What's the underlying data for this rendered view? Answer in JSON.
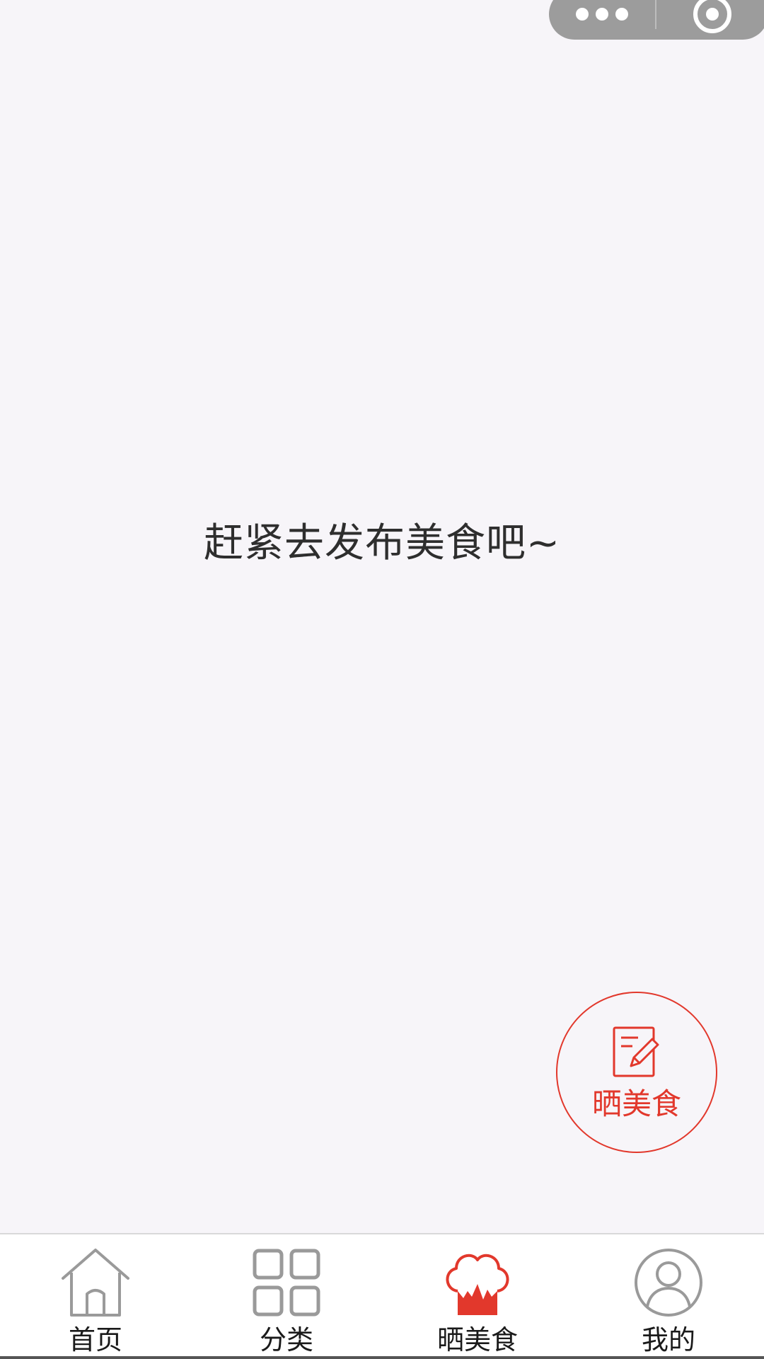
{
  "empty_state": {
    "message": "赶紧去发布美食吧~"
  },
  "fab": {
    "label": "晒美食",
    "icon": "edit-note-icon",
    "color": "#e2382c"
  },
  "tabbar": {
    "items": [
      {
        "label": "首页",
        "icon": "home-icon",
        "active": false
      },
      {
        "label": "分类",
        "icon": "grid-icon",
        "active": false
      },
      {
        "label": "晒美食",
        "icon": "chef-hat-icon",
        "active": true
      },
      {
        "label": "我的",
        "icon": "user-icon",
        "active": false
      }
    ],
    "active_color": "#e2382c",
    "inactive_color": "#9a9a9a"
  },
  "capsule": {
    "more_icon": "more-dots-icon",
    "close_icon": "target-close-icon"
  }
}
